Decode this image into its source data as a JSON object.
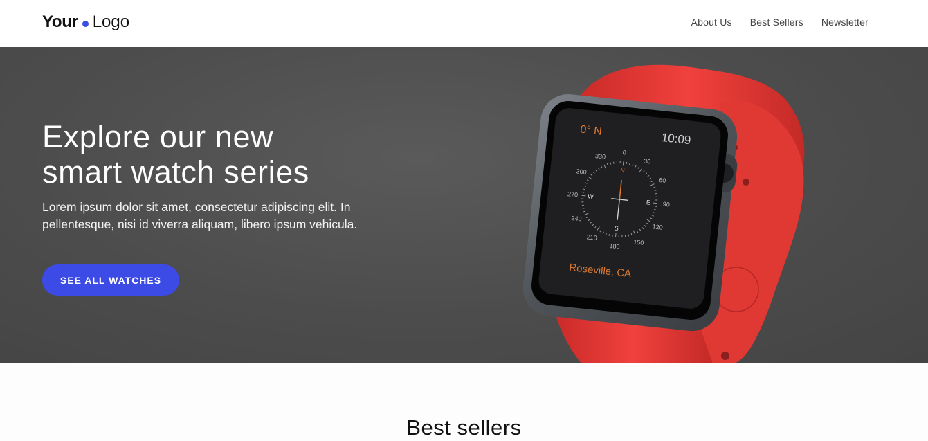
{
  "header": {
    "logo": {
      "strong": "Your",
      "light": "Logo"
    },
    "nav": [
      {
        "label": "About Us"
      },
      {
        "label": "Best Sellers"
      },
      {
        "label": "Newsletter"
      }
    ]
  },
  "hero": {
    "title_line1": "Explore our new",
    "title_line2": "smart watch series",
    "text": "Lorem ipsum dolor sit amet, consectetur adipiscing elit. In pellentesque, nisi id viverra aliquam, libero ipsum vehicula.",
    "cta_label": "SEE ALL WATCHES",
    "watch": {
      "heading": "0° N",
      "time": "10:09",
      "location": "Roseville, CA",
      "dial_numbers": [
        "0",
        "30",
        "60",
        "90",
        "120",
        "150",
        "180",
        "210",
        "240",
        "270",
        "300",
        "330"
      ],
      "cardinals": [
        "N",
        "E",
        "S",
        "W"
      ]
    }
  },
  "best_sellers": {
    "title": "Best sellers"
  },
  "colors": {
    "accent": "#3d4be6",
    "hero_bg": "#4f4f4f",
    "band": "#e83a36",
    "screen_text": "#d9782f"
  }
}
